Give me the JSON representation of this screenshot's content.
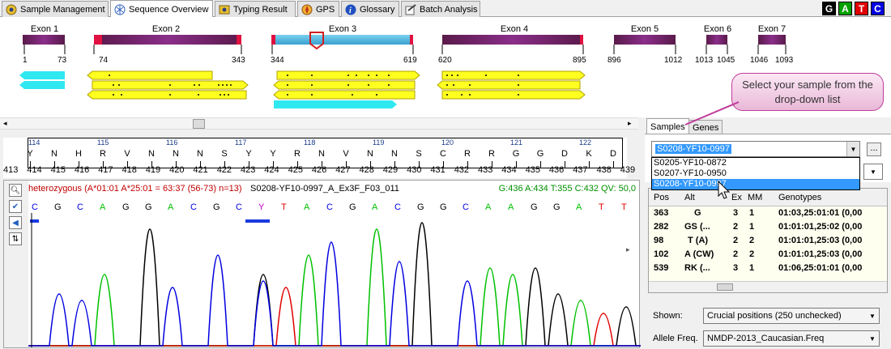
{
  "tabs": [
    {
      "label": "Sample Management",
      "icon": "sample-icon",
      "active": false
    },
    {
      "label": "Sequence Overview",
      "icon": "sequence-icon",
      "active": true
    },
    {
      "label": "Typing Result",
      "icon": "typing-icon",
      "active": false
    },
    {
      "label": "GPS",
      "icon": "gps-icon",
      "active": false
    },
    {
      "label": "Glossary",
      "icon": "info-icon",
      "active": false
    },
    {
      "label": "Batch Analysis",
      "icon": "batch-icon",
      "active": false
    }
  ],
  "gatc": [
    {
      "letter": "G",
      "color": "#000000"
    },
    {
      "letter": "A",
      "color": "#00a000"
    },
    {
      "letter": "T",
      "color": "#e00000"
    },
    {
      "letter": "C",
      "color": "#0000e0"
    }
  ],
  "exons": [
    {
      "name": "Exon 1",
      "start": "1",
      "end": "73"
    },
    {
      "name": "Exon 2",
      "start": "74",
      "end": "343"
    },
    {
      "name": "Exon 3",
      "start": "344",
      "end": "619"
    },
    {
      "name": "Exon 4",
      "start": "620",
      "end": "895"
    },
    {
      "name": "Exon 5",
      "start": "896",
      "end": "1012"
    },
    {
      "name": "Exon 6",
      "start": "1013",
      "end": "1045"
    },
    {
      "name": "Exon 7",
      "start": "1046",
      "end": "1093"
    }
  ],
  "codon_numbers": [
    "114",
    "115",
    "116",
    "117",
    "118",
    "119",
    "120",
    "121",
    "122"
  ],
  "amino_acids": [
    "Y",
    "N",
    "H",
    "R",
    "V",
    "N",
    "N",
    "N",
    "S",
    "Y",
    "Y",
    "R",
    "N",
    "V",
    "N",
    "N",
    "S",
    "C",
    "R",
    "R",
    "G",
    "G",
    "D",
    "K",
    "D"
  ],
  "positions": [
    "413",
    "414",
    "415",
    "416",
    "417",
    "418",
    "419",
    "420",
    "421",
    "422",
    "423",
    "424",
    "425",
    "426",
    "427",
    "428",
    "429",
    "430",
    "431",
    "432",
    "433",
    "434",
    "435",
    "436",
    "437",
    "438",
    "439"
  ],
  "trace": {
    "heterozygous": "heterozygous (A*01:01 A*25:01 = 63:37 (56-73) n=13)",
    "file": "S0208-YF10-0997_A_Ex3F_F03_011",
    "stats": "G:436 A:434 T:355 C:432 QV: 50,0",
    "bases": [
      "C",
      "G",
      "C",
      "A",
      "G",
      "G",
      "A",
      "C",
      "G",
      "C",
      "Y",
      "T",
      "A",
      "C",
      "G",
      "A",
      "C",
      "G",
      "G",
      "C",
      "A",
      "A",
      "G",
      "G",
      "A",
      "T",
      "T"
    ]
  },
  "right_panel": {
    "tabs": [
      "Samples",
      "Genes"
    ],
    "selected_sample": "S0208-YF10-0997",
    "browse_label": "...",
    "dropdown_items": [
      "S0205-YF10-0872",
      "S0207-YF10-0950",
      "S0208-YF10-0997"
    ],
    "grid_headers": [
      "Pos",
      "Alt",
      "Ex",
      "MM",
      "Genotypes"
    ],
    "grid_rows": [
      {
        "pos": "363",
        "alt": "G",
        "ex": "3",
        "mm": "1",
        "geno": "01:03,25:01:01 (0,00"
      },
      {
        "pos": "282",
        "alt": "GS (...",
        "ex": "2",
        "mm": "1",
        "geno": "01:01:01,25:02 (0,00"
      },
      {
        "pos": "98",
        "alt": "T (A)",
        "ex": "2",
        "mm": "2",
        "geno": "01:01:01,25:03 (0,00"
      },
      {
        "pos": "102",
        "alt": "A (CW)",
        "ex": "2",
        "mm": "2",
        "geno": "01:01:01,25:03 (0,00"
      },
      {
        "pos": "539",
        "alt": "RK (...",
        "ex": "3",
        "mm": "1",
        "geno": "01:06,25:01:01 (0,00"
      }
    ],
    "shown_label": "Shown:",
    "shown_value": "Crucial positions (250 unchecked)",
    "allele_label": "Allele Freq.",
    "allele_value": "NMDP-2013_Caucasian.Freq"
  },
  "callout": "Select your sample from the drop-down list"
}
